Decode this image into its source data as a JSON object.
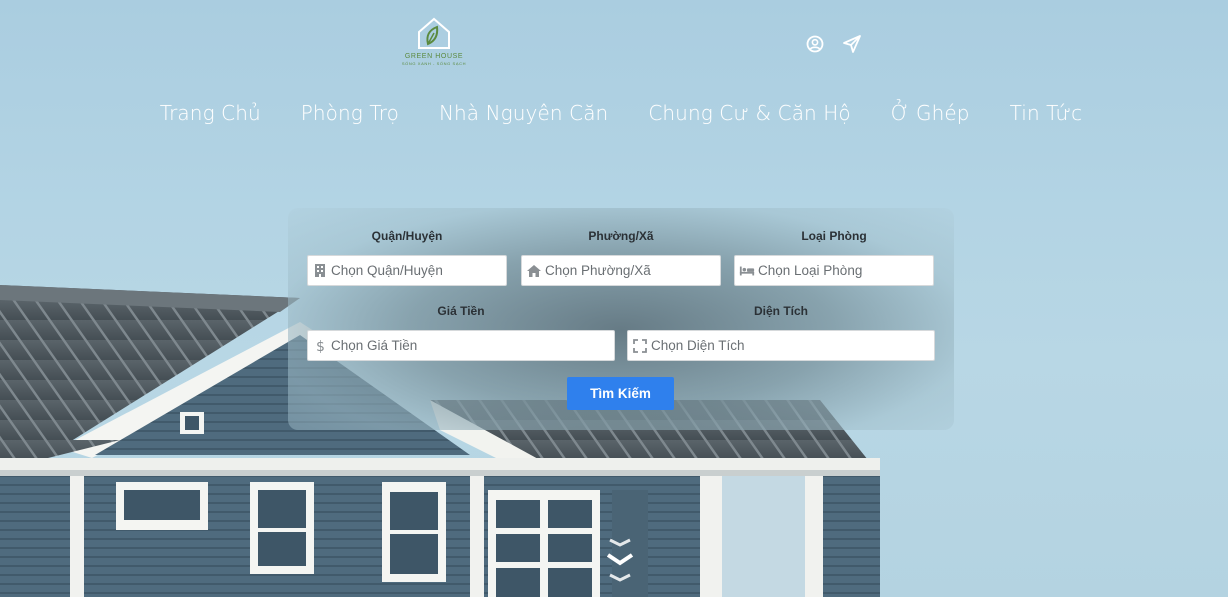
{
  "brand": {
    "name": "GREEN HOUSE",
    "tagline": "SỐNG XANH - SỐNG SẠCH",
    "color": "#5b8a3f"
  },
  "header_icons": [
    "user-circle-icon",
    "send-icon"
  ],
  "nav": {
    "items": [
      {
        "label": "Trang Chủ"
      },
      {
        "label": "Phòng Trọ"
      },
      {
        "label": "Nhà Nguyên Căn"
      },
      {
        "label": "Chung Cư & Căn Hộ"
      },
      {
        "label": "Ở Ghép"
      },
      {
        "label": "Tin Tức"
      }
    ]
  },
  "search": {
    "fields": [
      {
        "label": "Quận/Huyện",
        "placeholder": "Chọn Quận/Huyện",
        "icon": "building-icon"
      },
      {
        "label": "Phường/Xã",
        "placeholder": "Chọn Phường/Xã",
        "icon": "home-icon"
      },
      {
        "label": "Loại Phòng",
        "placeholder": "Chọn Loại Phòng",
        "icon": "bed-icon"
      },
      {
        "label": "Giá Tiền",
        "placeholder": "Chọn Giá Tiền",
        "icon": "dollar-icon"
      },
      {
        "label": "Diện Tích",
        "placeholder": "Chọn Diện Tích",
        "icon": "expand-icon"
      }
    ],
    "button_label": "Tìm Kiếm",
    "button_color": "#2f80ed"
  },
  "scroll_hint_icon": "chevrons-down-icon"
}
